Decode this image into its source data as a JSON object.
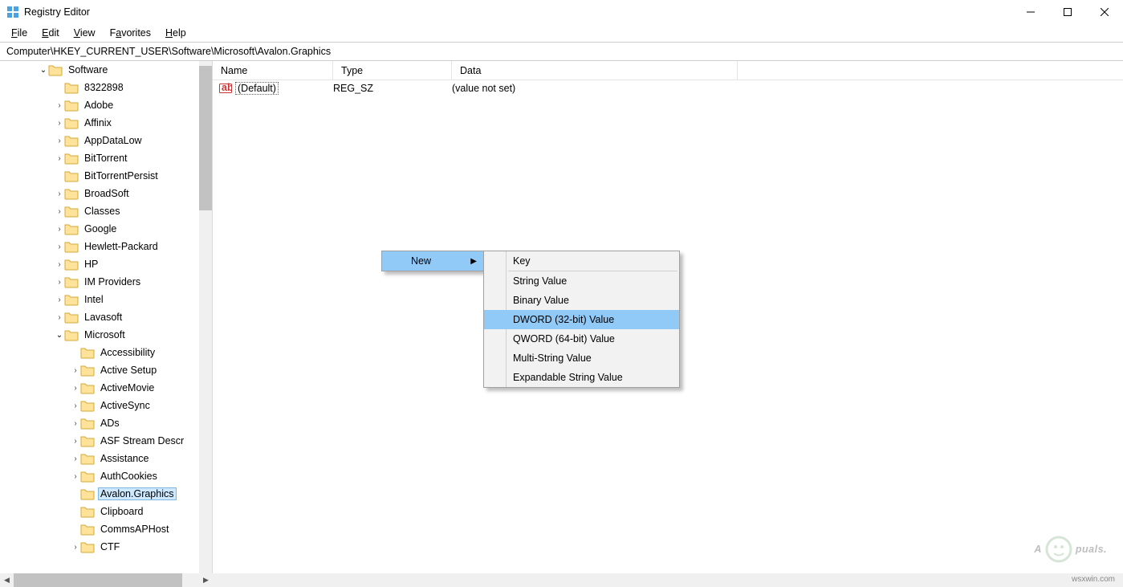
{
  "window": {
    "title": "Registry Editor"
  },
  "menubar": {
    "file": "File",
    "edit": "Edit",
    "view": "View",
    "favorites": "Favorites",
    "help": "Help"
  },
  "address": {
    "path": "Computer\\HKEY_CURRENT_USER\\Software\\Microsoft\\Avalon.Graphics"
  },
  "tree": {
    "software": "Software",
    "items1": [
      "8322898",
      "Adobe",
      "Affinix",
      "AppDataLow",
      "BitTorrent",
      "BitTorrentPersist",
      "BroadSoft",
      "Classes",
      "Google",
      "Hewlett-Packard",
      "HP",
      "IM Providers",
      "Intel",
      "Lavasoft"
    ],
    "microsoft": "Microsoft",
    "items2": [
      "Accessibility",
      "Active Setup",
      "ActiveMovie",
      "ActiveSync",
      "ADs",
      "ASF Stream Descr",
      "Assistance",
      "AuthCookies",
      "Avalon.Graphics",
      "Clipboard",
      "CommsAPHost",
      "CTF"
    ]
  },
  "list": {
    "cols": {
      "name": "Name",
      "type": "Type",
      "data": "Data"
    },
    "row0": {
      "name": "(Default)",
      "type": "REG_SZ",
      "data": "(value not set)"
    }
  },
  "ctx1": {
    "new": "New"
  },
  "ctx2": {
    "key": "Key",
    "string": "String Value",
    "binary": "Binary Value",
    "dword": "DWORD (32-bit) Value",
    "qword": "QWORD (64-bit) Value",
    "multi": "Multi-String Value",
    "expand": "Expandable String Value"
  },
  "watermark": "A  puals.",
  "srcnote": "wsxwin.com"
}
